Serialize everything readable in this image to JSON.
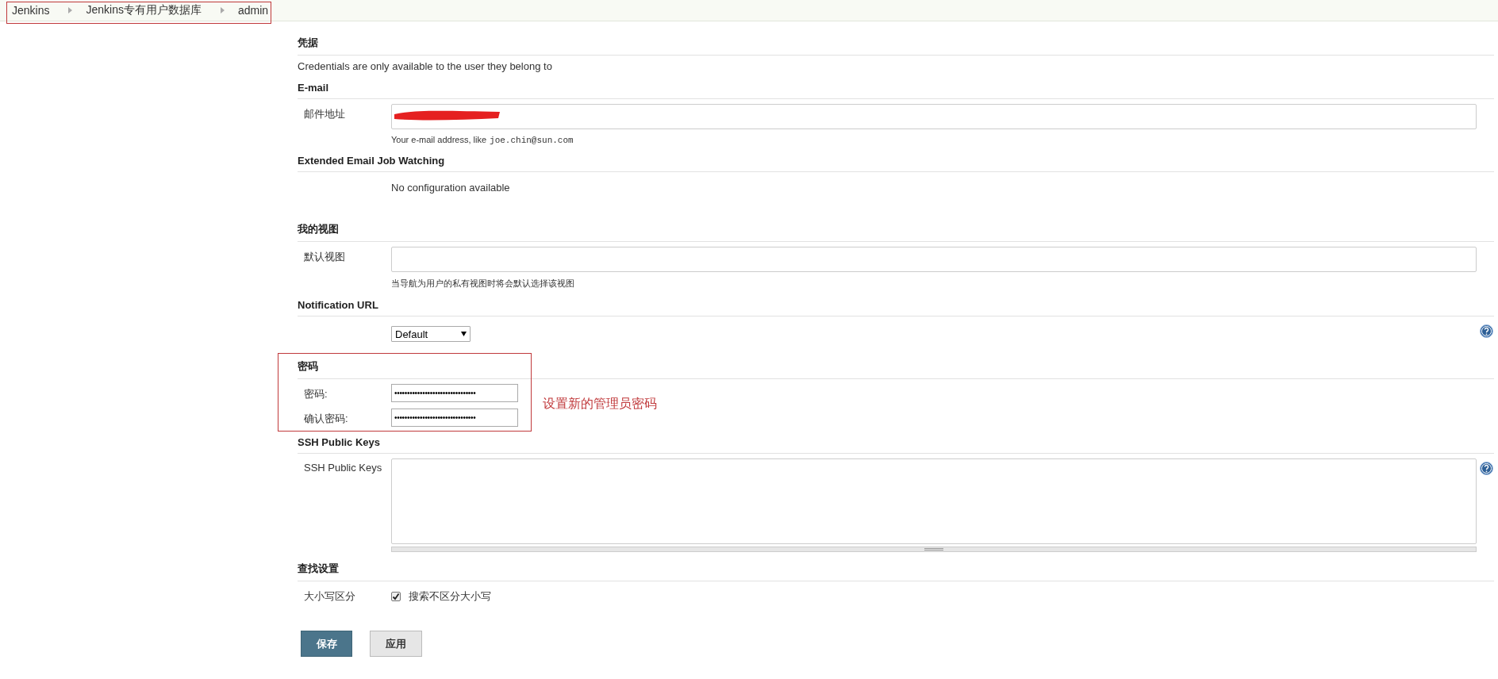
{
  "breadcrumb": {
    "highlighted": true,
    "items": [
      "Jenkins",
      "Jenkins专有用户数据库",
      "admin"
    ]
  },
  "sections": [
    {
      "title": "凭据",
      "highlighted": false,
      "rows": [
        {
          "kind": "description",
          "text": "Credentials are only available to the user they belong to",
          "help": false
        }
      ]
    },
    {
      "title": "E-mail",
      "highlighted": false,
      "rows": [
        {
          "kind": "input",
          "label": "邮件地址",
          "redacted": true,
          "hint": "Your e-mail address, like",
          "hint_code": "joe.chin@sun.com",
          "help": false
        }
      ]
    },
    {
      "title": "Extended Email Job Watching",
      "highlighted": false,
      "rows": [
        {
          "kind": "message",
          "text": "No configuration available",
          "help": false
        }
      ]
    },
    {
      "title": "我的视图",
      "highlighted": false,
      "rows": [
        {
          "kind": "input",
          "label": "默认视图",
          "redacted": false,
          "hint": "当导航为用户的私有视图时将会默认选择该视图",
          "help": false
        }
      ]
    },
    {
      "title": "Notification URL",
      "highlighted": false,
      "rows": [
        {
          "kind": "select",
          "value": "Default",
          "help": true
        }
      ]
    },
    {
      "title": "密码",
      "highlighted": true,
      "annotation": "设置新的管理员密码",
      "rows": [
        {
          "kind": "password",
          "label": "密码:",
          "value": "••••••••••••••••••••••••••••••••",
          "help": false
        },
        {
          "kind": "password",
          "label": "确认密码:",
          "value": "••••••••••••••••••••••••••••••••",
          "help": false
        }
      ]
    },
    {
      "title": "SSH Public Keys",
      "highlighted": false,
      "rows": [
        {
          "kind": "textarea",
          "label": "SSH Public Keys",
          "help": true
        }
      ]
    },
    {
      "title": "查找设置",
      "highlighted": false,
      "rows": [
        {
          "kind": "checkbox",
          "label": "大小写区分",
          "option": "搜索不区分大小写",
          "checked": true,
          "help": false
        }
      ]
    }
  ],
  "buttons": [
    {
      "label": "保存",
      "kind": "primary"
    },
    {
      "label": "应用",
      "kind": "secondary"
    }
  ]
}
